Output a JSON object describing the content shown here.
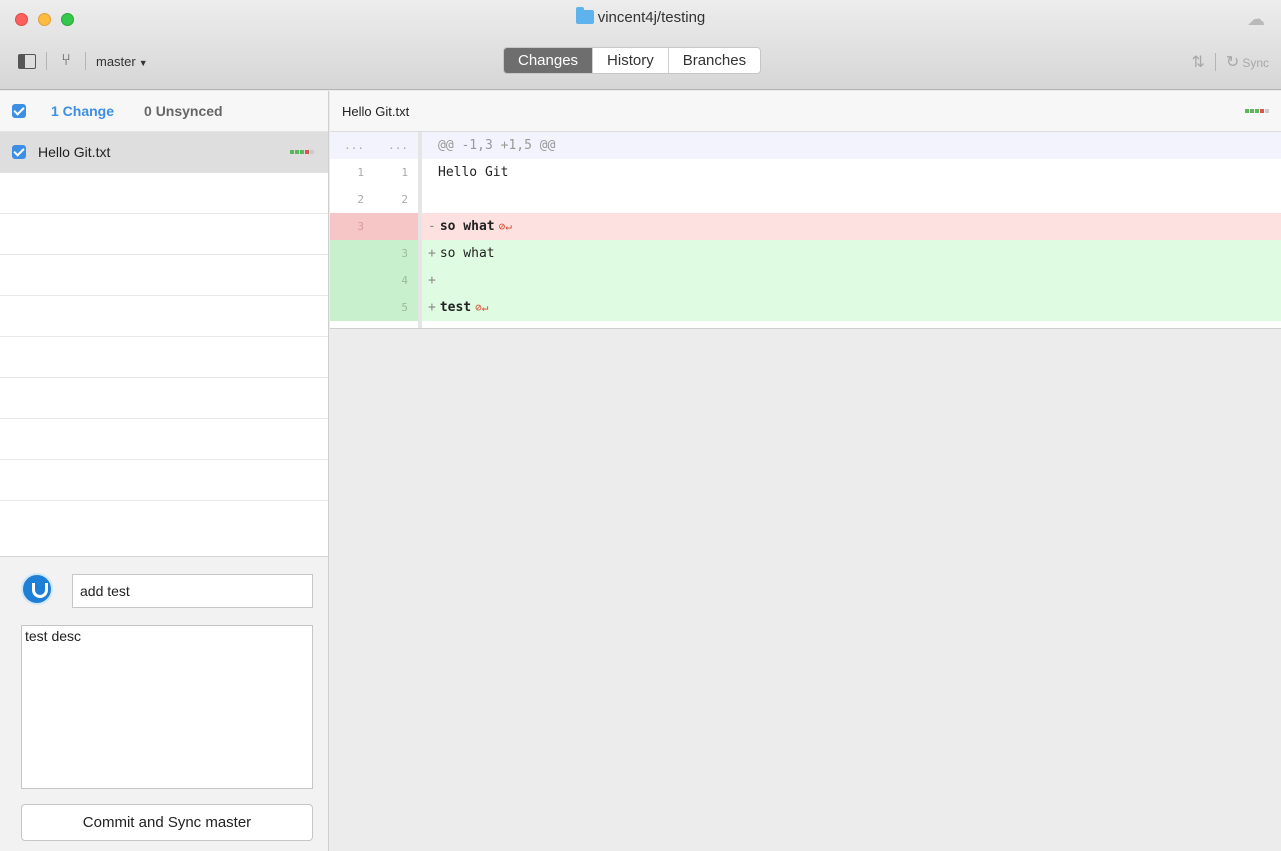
{
  "window": {
    "title": "vincent4j/testing"
  },
  "toolbar": {
    "branch": "master",
    "tabs": [
      "Changes",
      "History",
      "Branches"
    ],
    "active_tab": "Changes",
    "sync_label": "Sync"
  },
  "sidebar": {
    "changes_label": "1 Change",
    "unsynced_label": "0 Unsynced",
    "files": [
      {
        "name": "Hello Git.txt",
        "checked": true
      }
    ]
  },
  "commit": {
    "summary": "add test",
    "description": "test desc",
    "button_label": "Commit and Sync master"
  },
  "diff": {
    "file_name": "Hello Git.txt",
    "hunk_old_ln": "...",
    "hunk_new_ln": "...",
    "hunk_header": "@@ -1,3 +1,5 @@",
    "lines": [
      {
        "old": "1",
        "new": "1",
        "sign": "",
        "text": "Hello Git"
      },
      {
        "old": "2",
        "new": "2",
        "sign": "",
        "text": ""
      },
      {
        "old": "3",
        "new": "",
        "sign": "-",
        "text": "so what"
      },
      {
        "old": "",
        "new": "3",
        "sign": "+",
        "text": "so what"
      },
      {
        "old": "",
        "new": "4",
        "sign": "+",
        "text": ""
      },
      {
        "old": "",
        "new": "5",
        "sign": "+",
        "text": "test"
      }
    ]
  },
  "colors": {
    "accent": "#3d8fe4",
    "added": "#dffbe1",
    "deleted": "#fde0e0"
  }
}
